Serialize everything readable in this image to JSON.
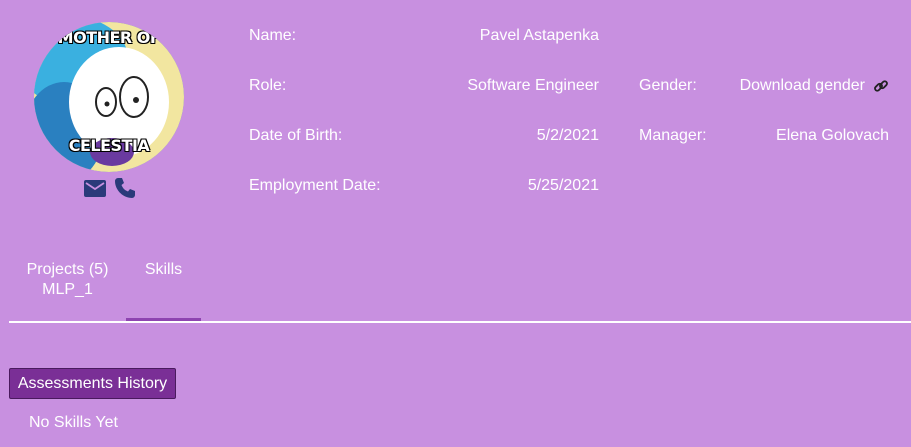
{
  "avatar": {
    "caption_top": "MOTHER OF",
    "caption_bottom": "CELESTIA"
  },
  "contact": {
    "icons": [
      "email-icon",
      "phone-icon"
    ],
    "icon_color": "#2a3a7a"
  },
  "profile": {
    "name_label": "Name:",
    "name_value": "Pavel Astapenka",
    "role_label": "Role:",
    "role_value": "Software Engineer",
    "dob_label": "Date of Birth:",
    "dob_value": "5/2/2021",
    "employment_label": "Employment Date:",
    "employment_value": "5/25/2021",
    "gender_label": "Gender:",
    "gender_value": "Download gender",
    "gender_icon": "link-icon",
    "manager_label": "Manager:",
    "manager_value": "Elena Golovach"
  },
  "tabs": {
    "projects_label": "Projects (5)",
    "projects_sub": "MLP_1",
    "skills_label": "Skills",
    "active": "Skills"
  },
  "skills": {
    "assessments_button": "Assessments History",
    "empty_text": "No Skills Yet"
  },
  "colors": {
    "background": "#c890e0",
    "button": "#7a2f96",
    "active_tab_underline": "#8e44b0"
  }
}
